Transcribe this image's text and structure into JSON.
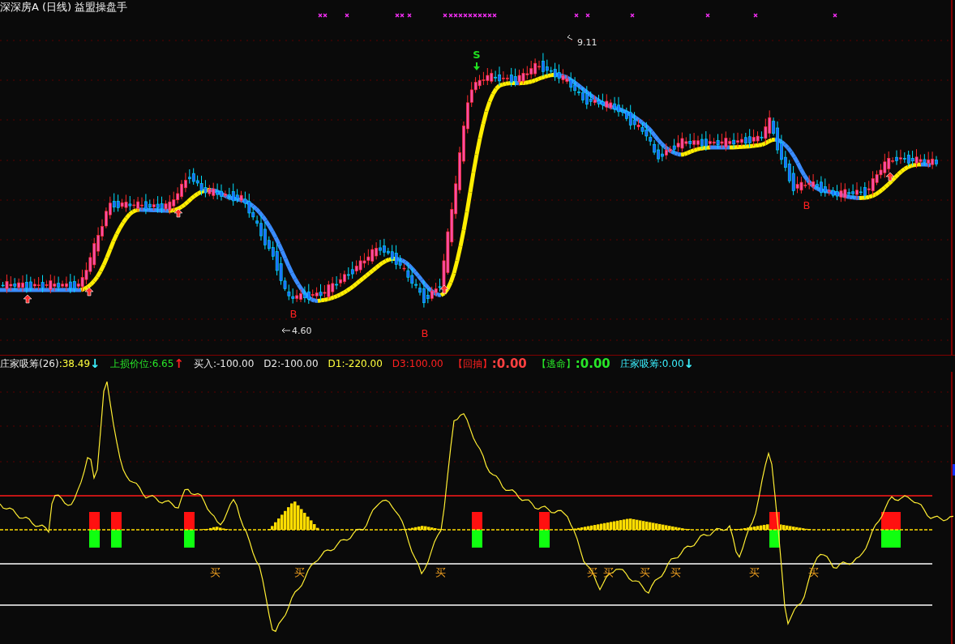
{
  "title": "深深房A (日线) 益盟操盘手",
  "indicator_readouts": [
    {
      "parts": [
        {
          "text": "庄家吸筹(26)",
          "color": "#e8e8e8"
        },
        {
          "text": ":38.49",
          "color": "#ffff3c"
        },
        {
          "text": "↓",
          "color": "#3cf0ff"
        }
      ]
    },
    {
      "parts": [
        {
          "text": "上损价位:6.65",
          "color": "#28e628"
        },
        {
          "text": "↑",
          "color": "#ff2020"
        }
      ]
    },
    {
      "parts": [
        {
          "text": "买入:-100.00",
          "color": "#e8e8e8"
        }
      ]
    },
    {
      "parts": [
        {
          "text": "D2:-100.00",
          "color": "#e8e8e8"
        }
      ]
    },
    {
      "parts": [
        {
          "text": "D1:-220.00",
          "color": "#ffff3c"
        }
      ]
    },
    {
      "parts": [
        {
          "text": "D3:100.00",
          "color": "#ff2020"
        }
      ]
    },
    {
      "parts": [
        {
          "text": "【回抽】",
          "color": "#ff2020"
        },
        {
          "text": ":0.00",
          "color": "#ff4040"
        }
      ]
    },
    {
      "parts": [
        {
          "text": "【逃命】",
          "color": "#28e628"
        },
        {
          "text": ":0.00",
          "color": "#28e628"
        }
      ]
    },
    {
      "parts": [
        {
          "text": "庄家吸筹:0.00",
          "color": "#3cf0ff"
        },
        {
          "text": "↓",
          "color": "#3cf0ff"
        }
      ]
    }
  ],
  "chart_marks": [
    {
      "kind": "sell",
      "text": "S"
    },
    {
      "kind": "buy",
      "text": "B"
    },
    {
      "kind": "buy",
      "text": "B"
    },
    {
      "kind": "buy",
      "text": "B"
    }
  ],
  "price_labels": [
    {
      "kind": "high",
      "text": "9.11"
    },
    {
      "kind": "low",
      "text": "4.60"
    }
  ],
  "buy_labels": [
    "买",
    "买",
    "买",
    "买",
    "买",
    "买",
    "买",
    "买",
    "买"
  ]
}
